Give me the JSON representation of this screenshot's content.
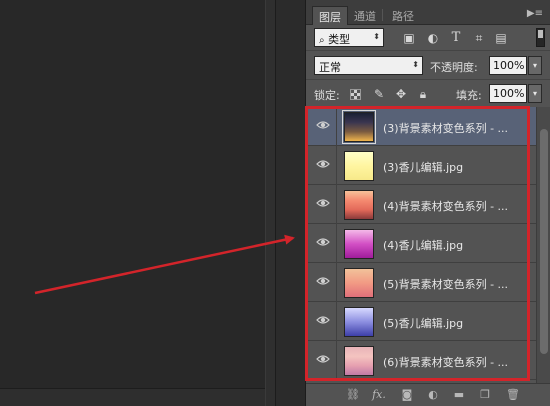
{
  "tabs": [
    "图层",
    "通道",
    "路径"
  ],
  "panel_menu_icon": "panel-menu-icon",
  "filter": {
    "kind_label": "类型",
    "search_icon": "search-icon"
  },
  "filter_icons": [
    "image-filter-icon",
    "adjustment-filter-icon",
    "type-filter-icon",
    "shape-filter-icon",
    "smart-object-filter-icon"
  ],
  "blend": {
    "mode": "正常",
    "opacity_label": "不透明度:",
    "opacity_value": "100%"
  },
  "lock": {
    "label": "锁定:",
    "fill_label": "填充:",
    "fill_value": "100%"
  },
  "lock_icons": [
    "lock-transparent-pixels-icon",
    "lock-image-pixels-icon",
    "lock-position-icon",
    "lock-all-icon"
  ],
  "layers": [
    {
      "name": "(3)背景素材变色系列 - ...",
      "selected": true,
      "thumb": [
        "#1a2033",
        "#3a3550",
        "#7a5a40",
        "#f0b44c"
      ]
    },
    {
      "name": "(3)香儿编辑.jpg",
      "selected": false,
      "thumb": [
        "#ffffc8",
        "#fff5a0",
        "#f7e98a"
      ]
    },
    {
      "name": "(4)背景素材变色系列 - ...",
      "selected": false,
      "thumb": [
        "#f7c29a",
        "#f58a70",
        "#e36a5a",
        "#8a3a3a"
      ]
    },
    {
      "name": "(4)香儿编辑.jpg",
      "selected": false,
      "thumb": [
        "#f4b8e8",
        "#d24fc4",
        "#a01c9a"
      ]
    },
    {
      "name": "(5)背景素材变色系列 - ...",
      "selected": false,
      "thumb": [
        "#f2c29a",
        "#f29a84",
        "#e06f7a"
      ]
    },
    {
      "name": "(5)香儿编辑.jpg",
      "selected": false,
      "thumb": [
        "#d7d9ff",
        "#8c8ee0",
        "#3d3fa8"
      ]
    },
    {
      "name": "(6)背景素材变色系列 - ...",
      "selected": false,
      "thumb": [
        "#e8b3b8",
        "#f4c4c0",
        "#e6a0b0",
        "#c07aa6"
      ]
    }
  ],
  "footer_icons": [
    "link-layers-icon",
    "layer-style-fx-icon",
    "add-mask-icon",
    "adjustment-layer-icon",
    "new-group-icon",
    "new-layer-icon",
    "trash-icon"
  ],
  "footer_fx_text": "fx.",
  "colors": {
    "selected_row": "#586277",
    "highlight": "#d3242a",
    "panel_bg": "#535353"
  }
}
